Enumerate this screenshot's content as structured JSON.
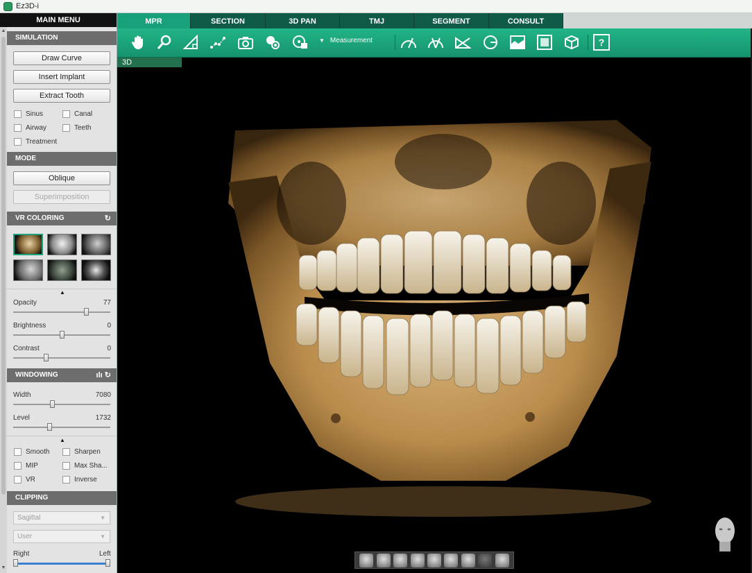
{
  "window": {
    "title": "Ez3D-i"
  },
  "sidebar": {
    "main_menu": "MAIN MENU",
    "simulation": {
      "header": "SIMULATION",
      "buttons": [
        "Draw Curve",
        "Insert Implant",
        "Extract Tooth"
      ],
      "checkboxes": [
        "Sinus",
        "Canal",
        "Airway",
        "Teeth",
        "Treatment"
      ]
    },
    "mode": {
      "header": "MODE",
      "oblique": "Oblique",
      "superimposition": "Superimposition"
    },
    "vr_coloring": {
      "header": "VR COLORING",
      "opacity_label": "Opacity",
      "opacity_value": "77",
      "opacity_fraction": 0.77,
      "brightness_label": "Brightness",
      "brightness_value": "0",
      "brightness_fraction": 0.5,
      "contrast_label": "Contrast",
      "contrast_value": "0",
      "contrast_fraction": 0.33
    },
    "windowing": {
      "header": "WINDOWING",
      "width_label": "Width",
      "width_value": "7080",
      "width_fraction": 0.4,
      "level_label": "Level",
      "level_value": "1732",
      "level_fraction": 0.37,
      "checkboxes": [
        "Smooth",
        "Sharpen",
        "MIP",
        "Max Sha...",
        "VR",
        "Inverse"
      ]
    },
    "clipping": {
      "header": "CLIPPING",
      "dropdown1": "Sagittal",
      "dropdown2": "User",
      "right_label": "Right",
      "left_label": "Left"
    }
  },
  "tabs": [
    "MPR",
    "SECTION",
    "3D PAN",
    "TMJ",
    "SEGMENT",
    "CONSULT"
  ],
  "active_tab": "MPR",
  "toolbar": {
    "measurement_label": "Measurement",
    "help_label": "?"
  },
  "viewport": {
    "label": "3D"
  },
  "colors": {
    "accent": "#17a07a",
    "tab_dark": "#105a48",
    "header_gray": "#6d6d6d"
  }
}
